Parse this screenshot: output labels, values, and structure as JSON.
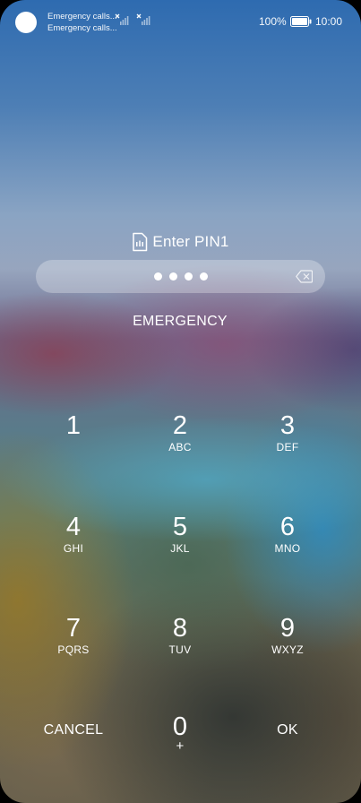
{
  "status_bar": {
    "carrier_1": "Emergency calls...",
    "carrier_2": "Emergency calls...",
    "battery_percent": "100%",
    "time": "10:00",
    "icons": [
      "notification-dot",
      "sim-no-service-icon",
      "sim-no-service-icon",
      "battery-full-icon"
    ]
  },
  "pin_entry": {
    "prompt": "Enter PIN1",
    "prompt_icon": "sim-card-icon",
    "entered_digits": 4,
    "backspace_icon": "backspace-icon"
  },
  "emergency_label": "EMERGENCY",
  "keypad": {
    "keys": [
      {
        "digit": "1",
        "letters": ""
      },
      {
        "digit": "2",
        "letters": "ABC"
      },
      {
        "digit": "3",
        "letters": "DEF"
      },
      {
        "digit": "4",
        "letters": "GHI"
      },
      {
        "digit": "5",
        "letters": "JKL"
      },
      {
        "digit": "6",
        "letters": "MNO"
      },
      {
        "digit": "7",
        "letters": "PQRS"
      },
      {
        "digit": "8",
        "letters": "TUV"
      },
      {
        "digit": "9",
        "letters": "WXYZ"
      },
      {
        "digit": "0",
        "letters": "+"
      }
    ],
    "cancel_label": "CANCEL",
    "ok_label": "OK"
  },
  "colors": {
    "text": "#ffffff",
    "field_background": "rgba(255,255,255,0.28)"
  }
}
